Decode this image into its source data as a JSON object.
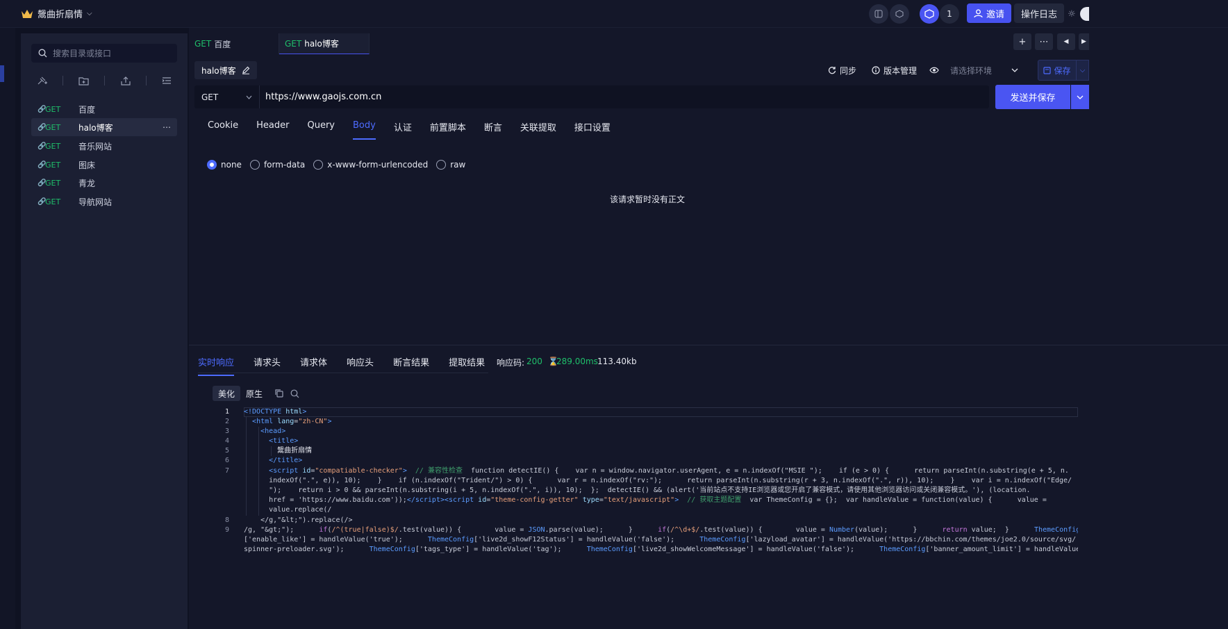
{
  "workspace": {
    "name": "鬶曲折扇情"
  },
  "topbar": {
    "count": "1",
    "invite_label": "邀请",
    "log_label": "操作日志"
  },
  "sidebar": {
    "search_placeholder": "搜索目录或接口",
    "items": [
      {
        "method": "GET",
        "name": "百度"
      },
      {
        "method": "GET",
        "name": "halo博客",
        "selected": true
      },
      {
        "method": "GET",
        "name": "音乐网站"
      },
      {
        "method": "GET",
        "name": "图床"
      },
      {
        "method": "GET",
        "name": "青龙"
      },
      {
        "method": "GET",
        "name": "导航网站"
      }
    ]
  },
  "tabs": [
    {
      "method": "GET",
      "name": "百度"
    },
    {
      "method": "GET",
      "name": "halo博客",
      "active": true
    }
  ],
  "request": {
    "name": "halo博客",
    "sync_label": "同步",
    "version_label": "版本管理",
    "env_placeholder": "请选择环境",
    "save_label": "保存",
    "method": "GET",
    "url": "https://www.gaojs.com.cn",
    "send_label": "发送并保存",
    "tabs": [
      "Cookie",
      "Header",
      "Query",
      "Body",
      "认证",
      "前置脚本",
      "断言",
      "关联提取",
      "接口设置"
    ],
    "active_tab": "Body",
    "body_types": [
      "none",
      "form-data",
      "x-www-form-urlencoded",
      "raw"
    ],
    "selected_body_type": "none",
    "empty_text": "该请求暂时没有正文"
  },
  "response": {
    "tabs": [
      "实时响应",
      "请求头",
      "请求体",
      "响应头",
      "断言结果",
      "提取结果"
    ],
    "active_tab": "实时响应",
    "status_label": "响应码:",
    "status_code": "200",
    "time": "289.00ms",
    "size": "113.40kb",
    "view_modes": [
      "美化",
      "原生"
    ],
    "active_view": "美化",
    "line_numbers": [
      "1",
      "2",
      "3",
      "4",
      "5",
      "6",
      "7",
      "8",
      "9"
    ]
  },
  "colors": {
    "accent": "#4d6bff",
    "get_method": "#1fbf6a",
    "primary_button": "#4a55f2"
  }
}
